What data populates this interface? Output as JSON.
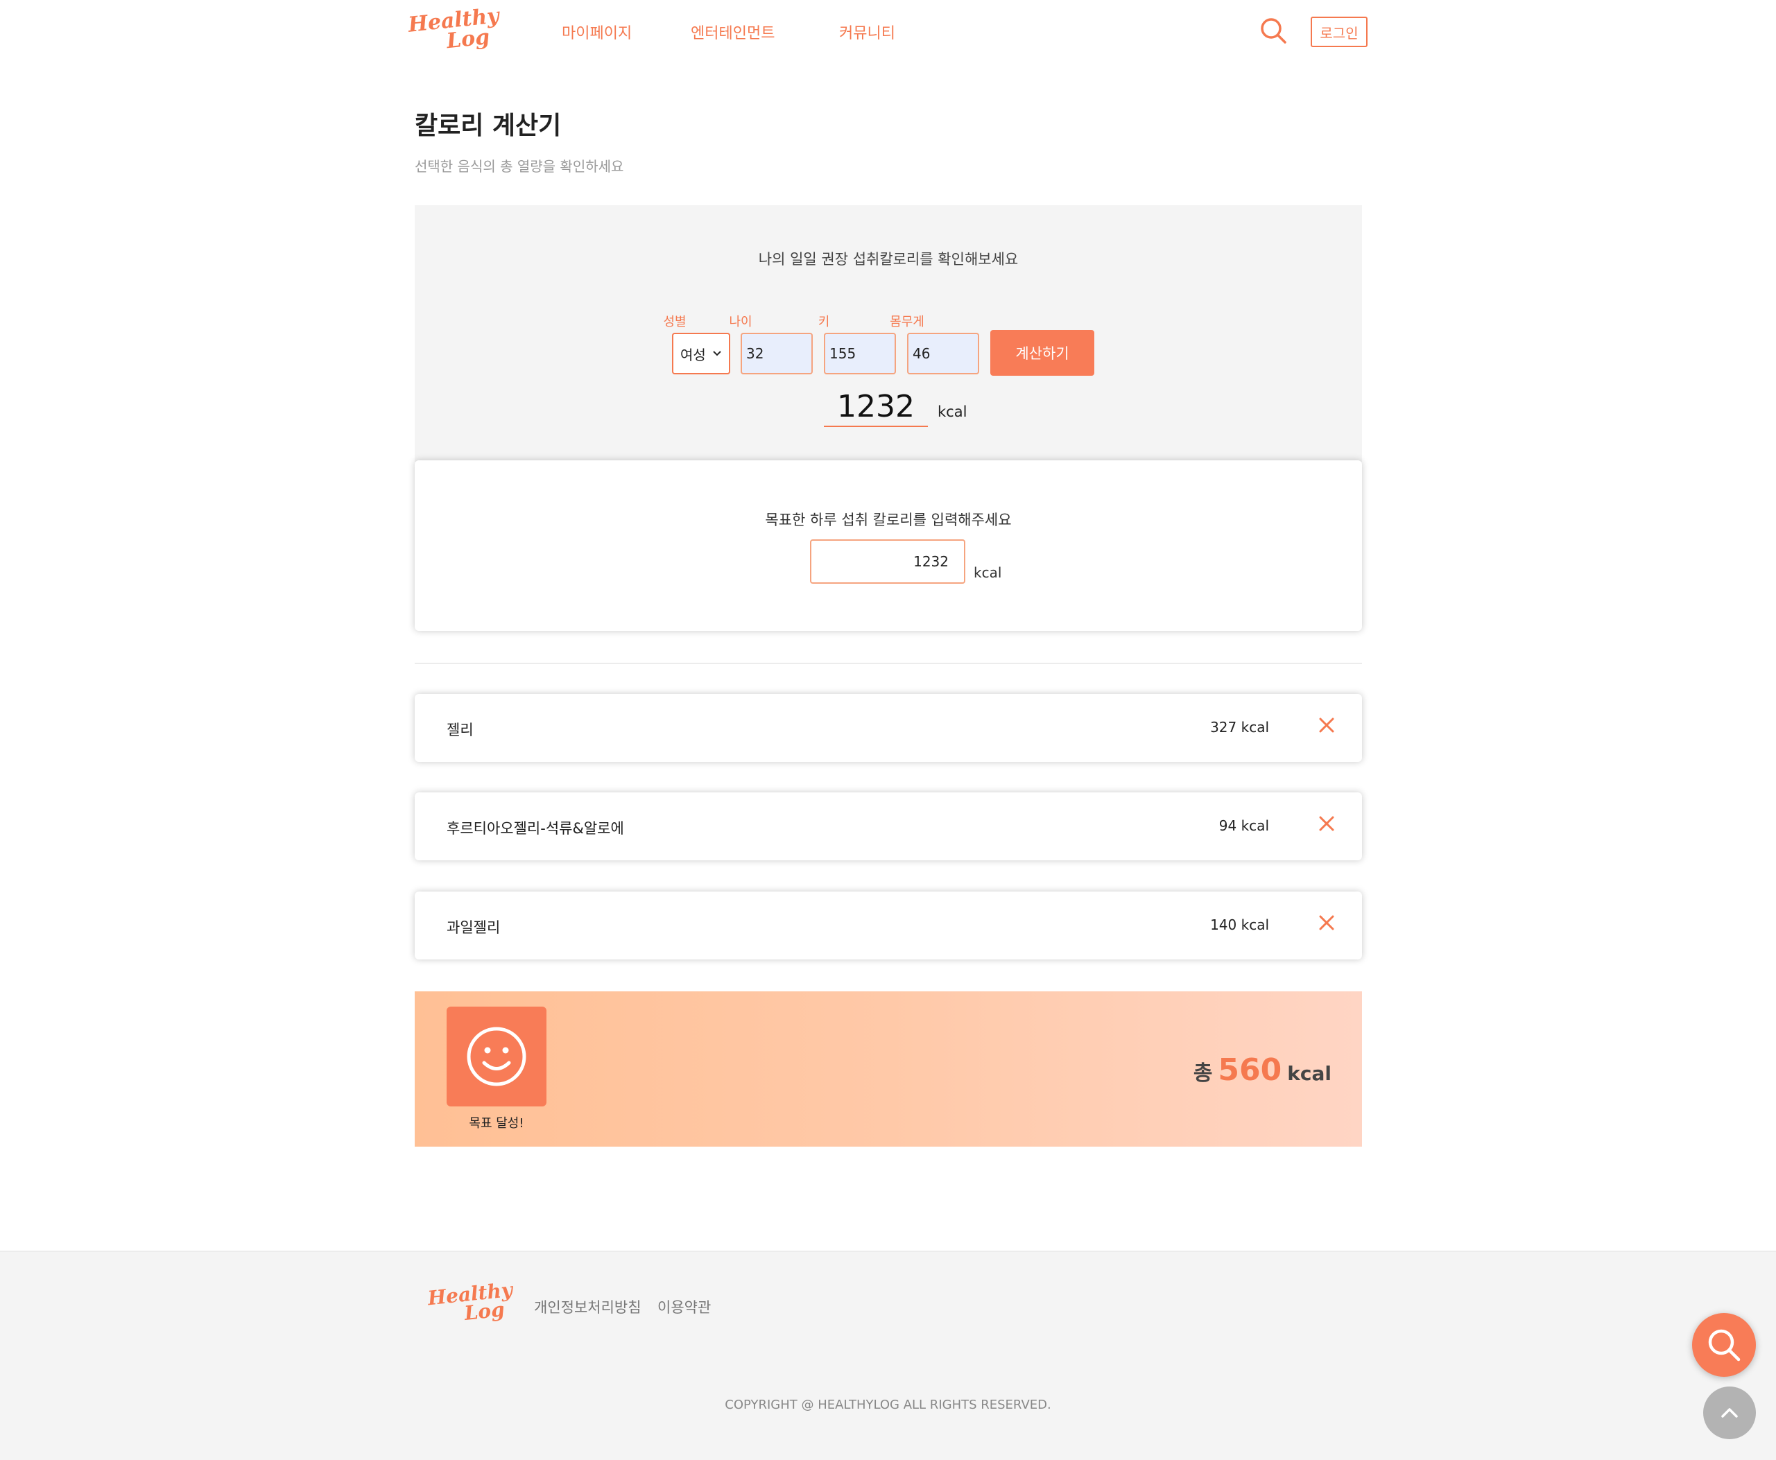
{
  "header": {
    "logo_line1": "Healthy",
    "logo_line2": "Log",
    "nav": [
      "마이페이지",
      "엔터테인먼트",
      "커뮤니티"
    ],
    "search_icon": "search-icon",
    "login_label": "로그인"
  },
  "page": {
    "title": "칼로리 계산기",
    "subtitle": "선택한 음식의 총 열량을 확인하세요"
  },
  "recommendation": {
    "heading": "나의 일일 권장 섭취칼로리를 확인해보세요",
    "labels": {
      "gender": "성별",
      "age": "나이",
      "height": "키",
      "weight": "몸무게"
    },
    "gender_value": "여성",
    "age_value": "32",
    "height_value": "155",
    "weight_value": "46",
    "calc_button": "계산하기",
    "result_value": "1232",
    "result_unit": "kcal"
  },
  "target": {
    "heading": "목표한 하루 섭취 칼로리를 입력해주세요",
    "value": "1232",
    "unit": "kcal"
  },
  "foods": [
    {
      "name": "젤리",
      "kcal": "327 kcal"
    },
    {
      "name": "후르티아오젤리-석류&알로에",
      "kcal": "94 kcal"
    },
    {
      "name": "과일젤리",
      "kcal": "140 kcal"
    }
  ],
  "summary": {
    "status_icon": "smiley-icon",
    "goal_label": "목표 달성!",
    "total_label": "총",
    "total_value": "560",
    "total_unit": "kcal"
  },
  "footer": {
    "logo_line1": "Healthy",
    "logo_line2": "Log",
    "links": [
      "개인정보처리방침",
      "이용약관"
    ],
    "copyright": "COPYRIGHT @ HEALTHYLOG ALL RIGHTS RESERVED."
  },
  "colors": {
    "accent": "#f5794f",
    "button": "#f87c57",
    "panel": "#f4f4f4"
  }
}
